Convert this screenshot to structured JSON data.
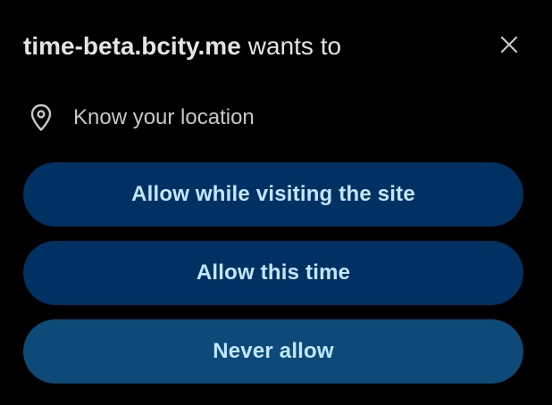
{
  "header": {
    "site": "time-beta.bcity.me",
    "suffix": "wants to"
  },
  "permission": {
    "icon": "location-pin-icon",
    "label": "Know your location"
  },
  "buttons": {
    "allow_visit": "Allow while visiting the site",
    "allow_once": "Allow this time",
    "never": "Never allow"
  },
  "colors": {
    "background": "#000000",
    "primary_button_bg": "#003163",
    "never_button_bg": "#0D4A77",
    "button_text": "#C2E7FF",
    "title_text": "#E3E3E3",
    "secondary_text": "#C7C7C7"
  }
}
